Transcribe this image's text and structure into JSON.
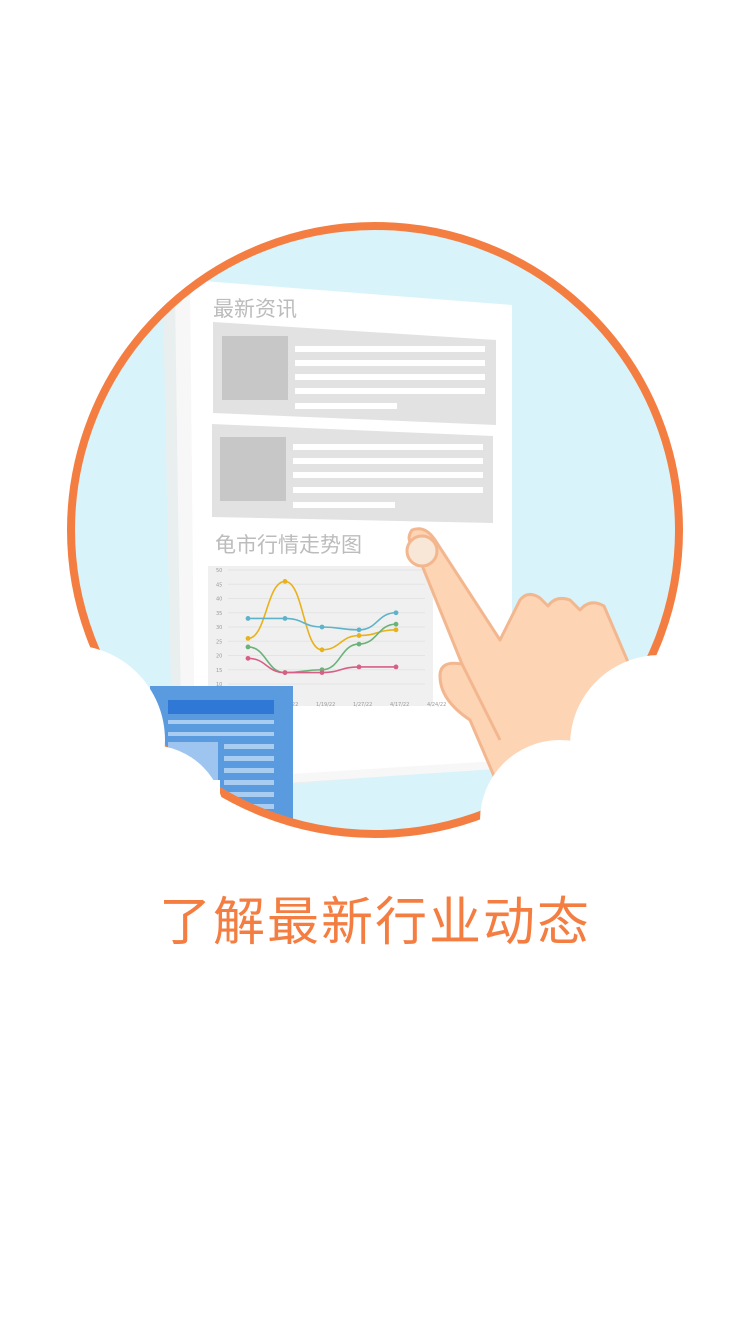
{
  "colors": {
    "accent": "#f47e41",
    "circle_fill": "#d8f4fa",
    "paper": "#ffffff",
    "placeholder": "#e2e2e2",
    "placeholder_thumb": "#c7c7c7",
    "heading_gray": "#bcbcbc",
    "hand": "#fdd4b4",
    "hand_outline": "#f3b78f",
    "doc_blue": "#5a9be0",
    "doc_dark_blue": "#2f78d6"
  },
  "illustration": {
    "news_heading": "最新资讯",
    "market_heading": "龟市行情走势图",
    "icons": [
      "hand-pointer-icon",
      "document-icon",
      "cloud-icon"
    ]
  },
  "chart_data": {
    "type": "line",
    "title": "",
    "xlabel": "",
    "ylabel": "",
    "ylim": [
      10,
      50
    ],
    "yticks": [
      "50",
      "45",
      "40",
      "35",
      "30",
      "25",
      "20",
      "15",
      "10"
    ],
    "categories": [
      "",
      "",
      "",
      "",
      "",
      ""
    ],
    "tick_labels": [
      "1/5/22",
      "1/12/22",
      "1/19/22",
      "1/27/22",
      "4/17/22",
      "4/24/22"
    ],
    "series": [
      {
        "color": "#e8b21a",
        "values": [
          26,
          46,
          22,
          27,
          29,
          null
        ]
      },
      {
        "color": "#5fb3c8",
        "values": [
          33,
          33,
          30,
          29,
          35,
          null
        ]
      },
      {
        "color": "#6ab278",
        "values": [
          23,
          14,
          15,
          24,
          31,
          null
        ]
      },
      {
        "color": "#d75f86",
        "values": [
          19,
          14,
          14,
          16,
          16,
          null
        ]
      }
    ],
    "grid": true,
    "legend": "none"
  },
  "tagline": "了解最新行业动态"
}
